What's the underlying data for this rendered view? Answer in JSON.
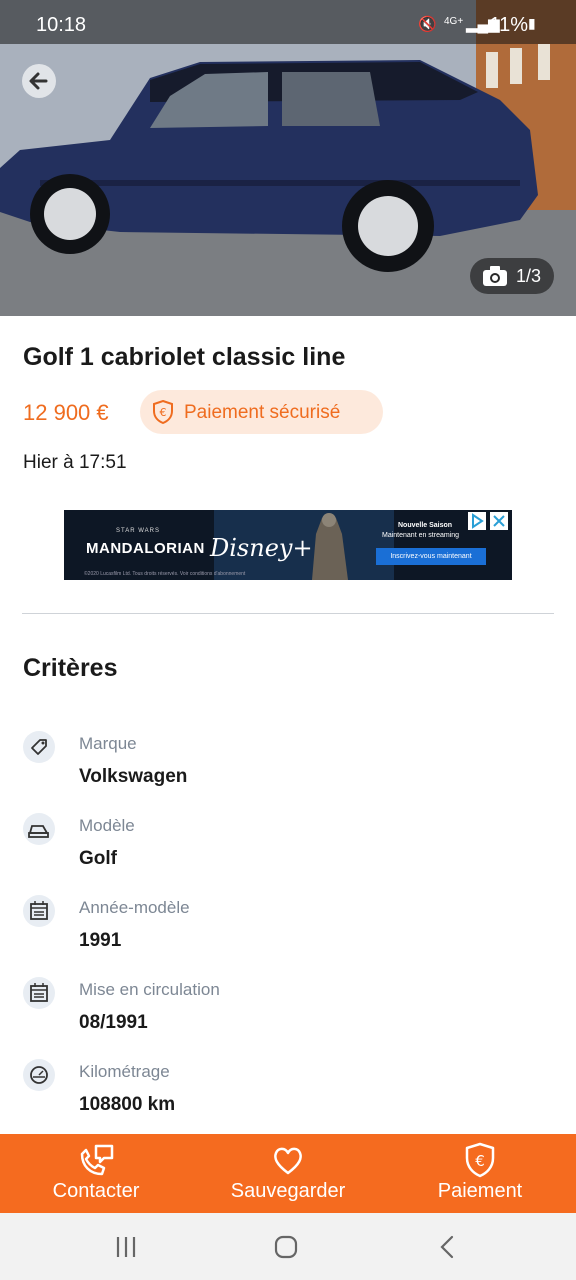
{
  "status_bar": {
    "time": "10:18",
    "network": "4G+",
    "battery": "11%"
  },
  "gallery": {
    "counter": "1/3"
  },
  "listing": {
    "title": "Golf 1 cabriolet classic line",
    "price": "12 900 €",
    "secure_payment_label": "Paiement sécurisé",
    "posted_at": "Hier à 17:51"
  },
  "ad": {
    "brand": "MANDALORIAN",
    "franchise": "STAR WARS",
    "service": "Disney+",
    "season": "Nouvelle Saison",
    "streaming": "Maintenant en streaming",
    "cta": "Inscrivez-vous maintenant",
    "fine_print": "©2020 Lucasfilm Ltd. Tous droits réservés. Voir conditions d'abonnement"
  },
  "criteria": {
    "heading": "Critères",
    "items": [
      {
        "label": "Marque",
        "value": "Volkswagen",
        "icon": "tag-icon"
      },
      {
        "label": "Modèle",
        "value": "Golf",
        "icon": "car-icon"
      },
      {
        "label": "Année-modèle",
        "value": "1991",
        "icon": "calendar-icon"
      },
      {
        "label": "Mise en circulation",
        "value": "08/1991",
        "icon": "calendar-icon"
      },
      {
        "label": "Kilométrage",
        "value": "108800 km",
        "icon": "speedometer-icon"
      }
    ]
  },
  "actions": {
    "contact": "Contacter",
    "save": "Sauvegarder",
    "pay": "Paiement"
  },
  "colors": {
    "accent": "#f56b1f",
    "accent_soft": "#fde9dc",
    "muted": "#7d8794"
  }
}
